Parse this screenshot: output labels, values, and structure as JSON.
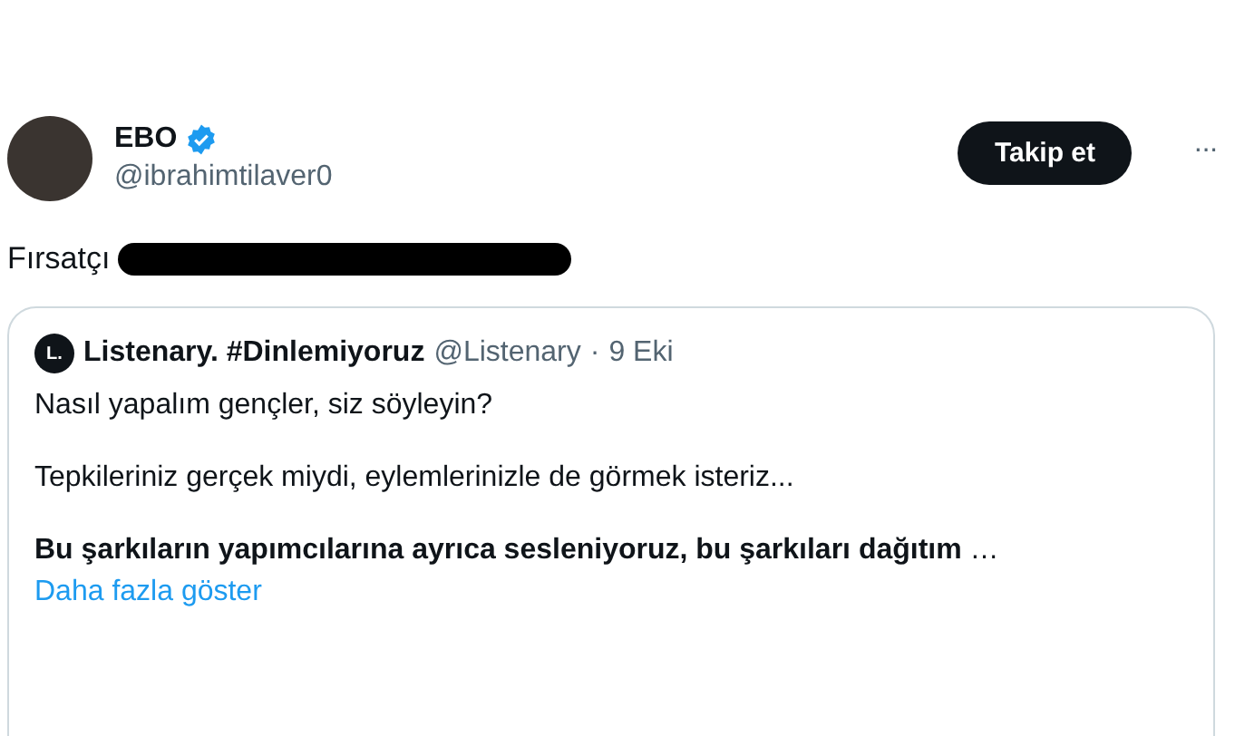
{
  "author": {
    "name": "EBO",
    "verified": true,
    "handle": "@ibrahimtilaver0"
  },
  "follow_button": "Takip et",
  "more_menu": "···",
  "tweet": {
    "text": "Fırsatçı",
    "redacted": true
  },
  "quote": {
    "avatar_letter": "L.",
    "name": "Listenary. #Dinlemiyoruz",
    "handle": "@Listenary",
    "separator": "·",
    "date": "9 Eki",
    "paragraphs": [
      "Nasıl yapalım gençler, siz söyleyin?",
      "Tepkileriniz gerçek miydi, eylemlerinizle de görmek isteriz...",
      "**Bu şarkıların yapımcılarına ayrıca sesleniyoruz, bu şarkıları dağıtım** …"
    ],
    "show_more": "Daha fazla göster"
  }
}
